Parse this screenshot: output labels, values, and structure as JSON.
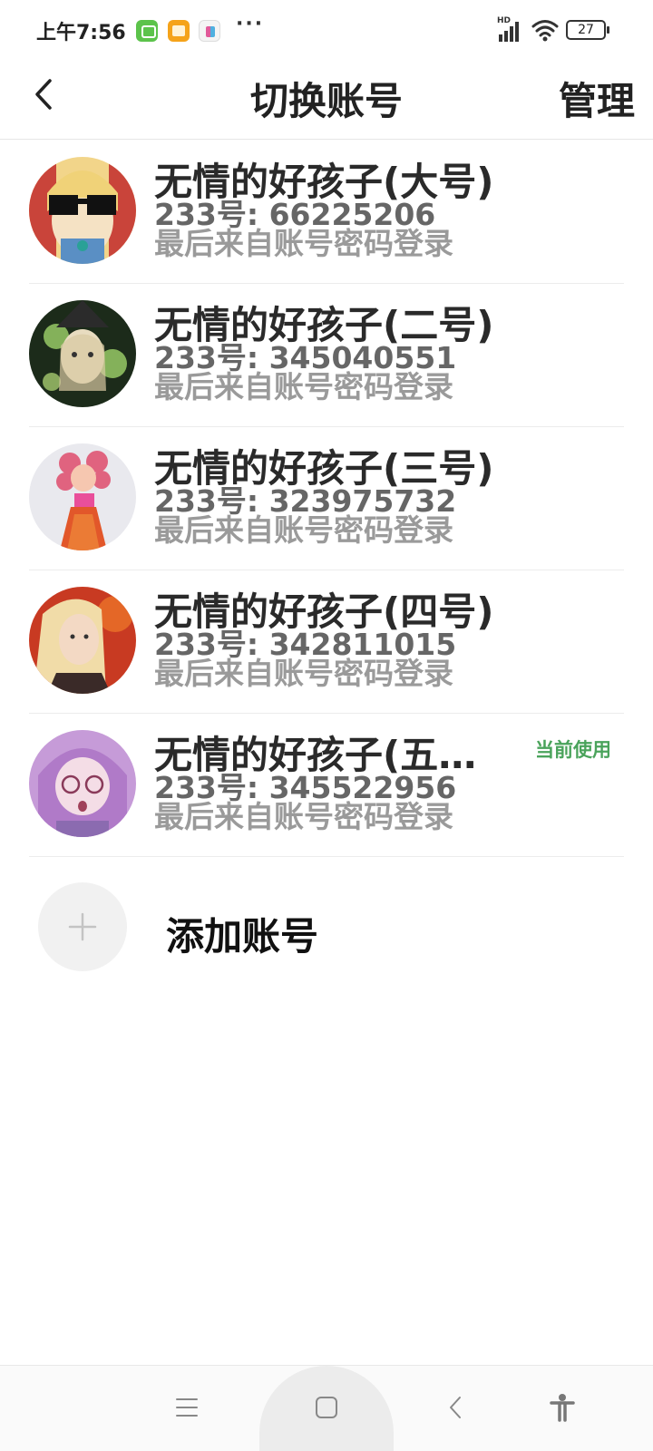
{
  "status_bar": {
    "time": "上午7:56",
    "network_label": "HD",
    "battery_level": "27"
  },
  "header": {
    "title": "切换账号",
    "manage_label": "管理"
  },
  "accounts": [
    {
      "name": "无情的好孩子(大号)",
      "id_text": "233号: 66225206",
      "login_text": "最后来自账号密码登录",
      "avatar": "avatar-blonde-sunglasses"
    },
    {
      "name": "无情的好孩子(二号)",
      "id_text": "233号: 345040551",
      "login_text": "最后来自账号密码登录",
      "avatar": "avatar-witch-flowers"
    },
    {
      "name": "无情的好孩子(三号)",
      "id_text": "233号: 323975732",
      "login_text": "最后来自账号密码登录",
      "avatar": "avatar-pink-doll"
    },
    {
      "name": "无情的好孩子(四号)",
      "id_text": "233号: 342811015",
      "login_text": "最后来自账号密码登录",
      "avatar": "avatar-blonde-woman"
    },
    {
      "name": "无情的好孩子(五…",
      "id_text": "233号: 345522956",
      "login_text": "最后来自账号密码登录",
      "avatar": "avatar-purple-glasses-girl",
      "badge": "当前使用"
    }
  ],
  "add_account": {
    "label": "添加账号"
  },
  "colors": {
    "current_badge": "#4aa35b",
    "name_text": "#2a2a2a",
    "id_text": "#666666",
    "login_text": "#9a9a9a"
  },
  "icons": {
    "back": "chevron-left-icon",
    "add": "plus-icon",
    "nav_menu": "menu-icon",
    "nav_home": "home-square-icon",
    "nav_back": "back-triangle-icon",
    "nav_accessibility": "accessibility-icon"
  }
}
